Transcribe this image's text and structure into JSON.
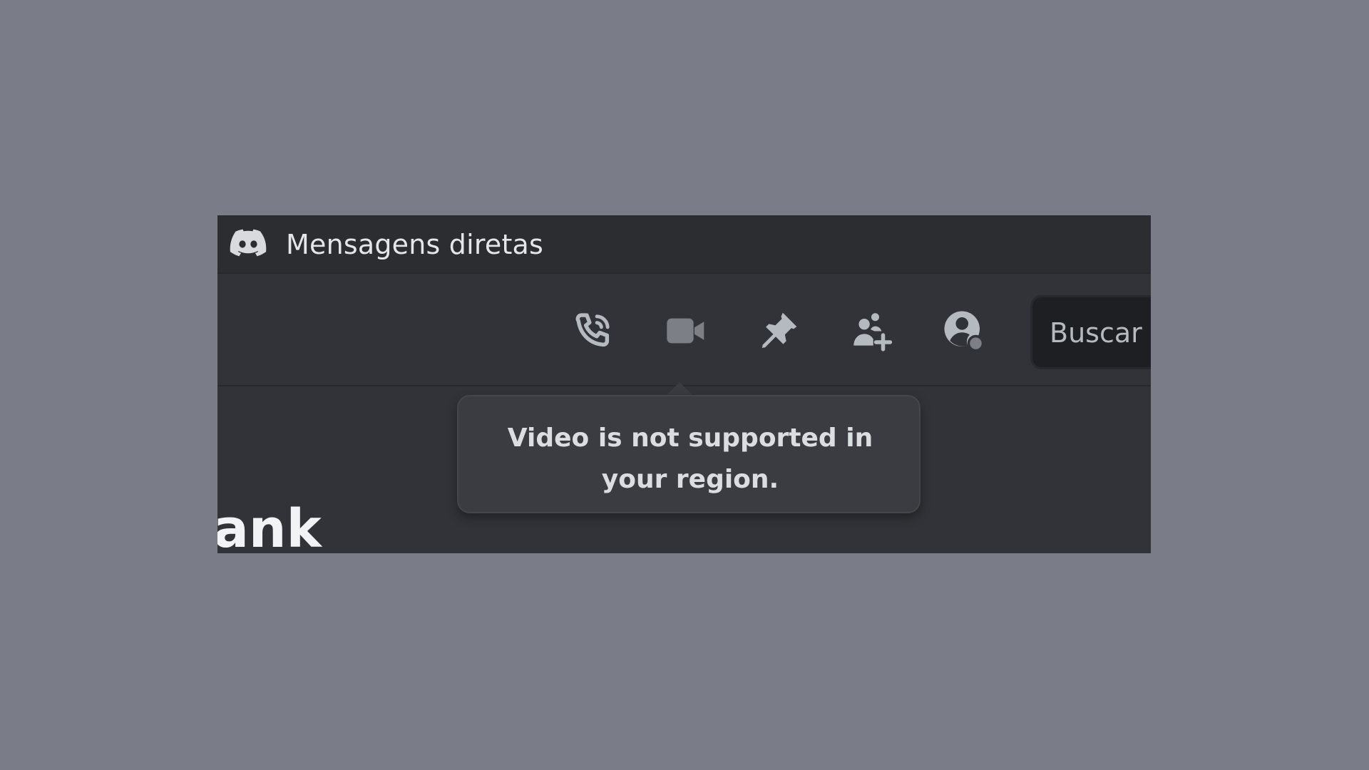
{
  "titlebar": {
    "app_icon": "discord-logo",
    "title": "Mensagens diretas"
  },
  "toolbar": {
    "buttons": [
      {
        "name": "voice-call",
        "icon": "phone-call-icon"
      },
      {
        "name": "video-call",
        "icon": "video-camera-icon"
      },
      {
        "name": "pinned-messages",
        "icon": "pin-icon"
      },
      {
        "name": "add-friends-to-dm",
        "icon": "add-user-icon"
      },
      {
        "name": "user-profile",
        "icon": "user-profile-icon"
      }
    ],
    "search": {
      "placeholder": "Buscar",
      "value": ""
    }
  },
  "tooltip": {
    "text": "Video is not supported in your region."
  },
  "content": {
    "visible_text": "ank"
  },
  "colors": {
    "backdrop": "#7a7d87",
    "titlebar_bg": "#2b2d31",
    "main_bg": "#313338",
    "icon": "#b5bac1",
    "icon_disabled": "#7c7f86",
    "tooltip_bg": "#3a3c41",
    "text_primary": "#f2f3f5"
  }
}
